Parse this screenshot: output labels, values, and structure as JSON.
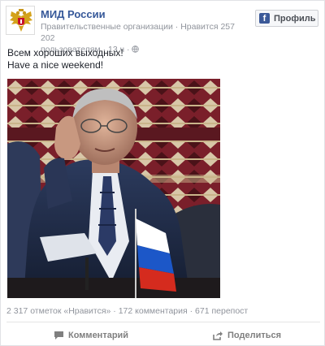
{
  "post": {
    "page_name": "МИД России",
    "meta_line1": "Правительственные организации · Нравится 257 202",
    "meta_line2": "пользователям · 13 ч ·",
    "profile_button": "Профиль",
    "text_line1": "Всем хороших выходных!",
    "text_line2": "Have a nice weekend!",
    "stats": "2 317 отметок «Нравится» · 172 комментария · 671 перепост"
  },
  "actions": {
    "comment_label": "Комментарий",
    "share_label": "Поделиться"
  },
  "colors": {
    "link_blue": "#365899",
    "facebook_blue": "#3b5998",
    "meta_gray": "#90949c"
  },
  "icons": [
    "russian-coat-of-arms-icon",
    "globe-icon",
    "facebook-icon",
    "comment-icon",
    "share-icon"
  ]
}
